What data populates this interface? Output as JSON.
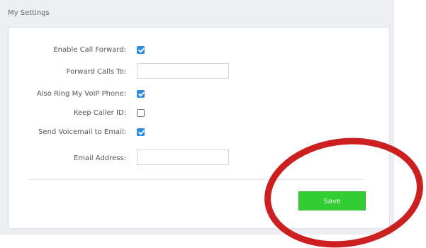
{
  "header": {
    "title": "My Settings"
  },
  "form": {
    "enable_call_forward": {
      "label": "Enable Call Forward:",
      "checked": true
    },
    "forward_calls_to": {
      "label": "Forward Calls To:",
      "value": "",
      "placeholder": ""
    },
    "also_ring_voip": {
      "label": "Also Ring My VoIP Phone:",
      "checked": true
    },
    "keep_caller_id": {
      "label": "Keep Caller ID:",
      "checked": false
    },
    "send_voicemail_email": {
      "label": "Send Voicemail to Email:",
      "checked": true
    },
    "email_address": {
      "label": "Email Address:",
      "value": "",
      "placeholder": ""
    }
  },
  "actions": {
    "save_label": "Save"
  },
  "colors": {
    "accent_checkbox": "#2a8be0",
    "save_button": "#33cc33",
    "annotation_circle": "#cc1f1f"
  }
}
